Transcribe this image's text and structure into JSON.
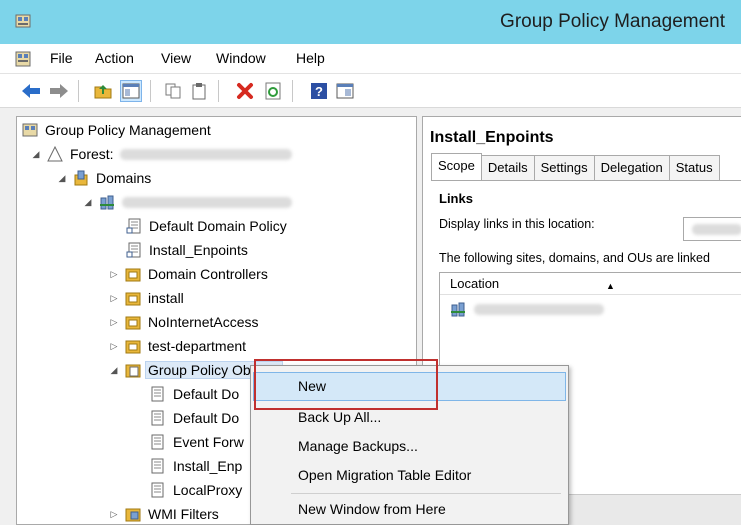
{
  "window": {
    "title": "Group Policy Management"
  },
  "menu": [
    "File",
    "Action",
    "View",
    "Window",
    "Help"
  ],
  "toolbar": {
    "icons": [
      "back-icon",
      "forward-icon",
      "up-folder-icon",
      "console-tree-icon",
      "copy-icon",
      "paste-icon",
      "delete-icon",
      "refresh-icon",
      "help-icon",
      "properties-icon"
    ]
  },
  "tree": {
    "root": "Group Policy Management",
    "forest_label": "Forest:",
    "domains": "Domains",
    "items": [
      "Default Domain Policy",
      "Install_Enpoints",
      "Domain Controllers",
      "install",
      "NoInternetAccess",
      "test-department",
      "Group Policy Objects"
    ],
    "gpo_children": [
      "Default Do",
      "Default Do",
      "Event Forw",
      "Install_Enp",
      "LocalProxy"
    ],
    "wmi": "WMI Filters"
  },
  "right": {
    "title": "Install_Enpoints",
    "tabs": [
      "Scope",
      "Details",
      "Settings",
      "Delegation",
      "Status"
    ],
    "links_heading": "Links",
    "display_links": "Display links in this location:",
    "following": "The following sites, domains, and OUs are linked",
    "location_header": "Location"
  },
  "context_menu": [
    "New",
    "Back Up All...",
    "Manage Backups...",
    "Open Migration Table Editor",
    "New Window from Here"
  ],
  "colors": {
    "titlebar": "#7dd4ea",
    "highlight_border": "#c0302e",
    "menu_hover": "#d4e8f8"
  }
}
